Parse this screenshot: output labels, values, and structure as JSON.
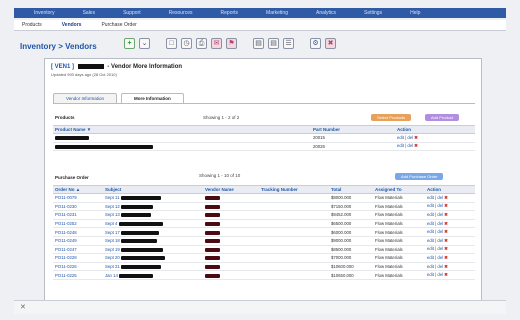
{
  "nav": {
    "top_items": [
      "Inventory",
      "Sales",
      "Support",
      "Resources",
      "Reports",
      "Marketing",
      "Analytics",
      "Settings",
      "Help"
    ],
    "sub_items": [
      {
        "label": "Products",
        "active": false
      },
      {
        "label": "Vendors",
        "active": true
      },
      {
        "label": "Purchase Order",
        "active": false
      }
    ]
  },
  "breadcrumb": "Inventory > Vendors",
  "toolbar_icons": [
    "add-icon",
    "chevron-icon",
    "window-icon",
    "clock-icon",
    "print-icon",
    "email-icon",
    "tag-icon",
    "doc-icon",
    "doc-icon",
    "list-icon",
    "settings-icon",
    "tools-icon"
  ],
  "vendor": {
    "ref": "[ VEN1 ]",
    "title_suffix": "- Vendor More Information",
    "updated": "Updated 993 days ago (28 Oct 2010)"
  },
  "tabs": [
    {
      "label": "Vendor Information",
      "active": false
    },
    {
      "label": "More Information",
      "active": true
    }
  ],
  "products": {
    "label": "Products",
    "showing": "Showing 1 - 2 of 2",
    "select_button": "Select Products",
    "add_button": "Add Product",
    "columns": [
      "Product Name ▼",
      "Part Number",
      "Action"
    ],
    "rows": [
      {
        "part": "20015",
        "action": "edit | del"
      },
      {
        "part": "20026",
        "action": "edit | del"
      }
    ]
  },
  "purchase_orders": {
    "label": "Purchase Order",
    "showing": "Showing 1 - 10 of 10",
    "add_button": "Add Purchase Order",
    "columns": [
      "Order No ▲",
      "Subject",
      "Vendor Name",
      "Tracking Number",
      "Total",
      "Assigned To",
      "Action"
    ],
    "rows": [
      {
        "order": "PO11-0079",
        "subject": "Sept 11",
        "total": "$8000.000",
        "assigned": "Flow Materials",
        "action": "edit | del"
      },
      {
        "order": "PO11-0230",
        "subject": "Sept 12",
        "total": "$7150.000",
        "assigned": "Flow Materials",
        "action": "edit | del"
      },
      {
        "order": "PO11-0231",
        "subject": "Sept 13",
        "total": "$9452.000",
        "assigned": "Flow Materials",
        "action": "edit | del"
      },
      {
        "order": "PO11-0252",
        "subject": "Sept 4",
        "total": "$6500.000",
        "assigned": "Flow Materials",
        "action": "edit | del"
      },
      {
        "order": "PO11-0248",
        "subject": "Sept 17",
        "total": "$6000.000",
        "assigned": "Flow Materials",
        "action": "edit | del"
      },
      {
        "order": "PO11-0249",
        "subject": "Sept 18",
        "total": "$9000.000",
        "assigned": "Flow Materials",
        "action": "edit | del"
      },
      {
        "order": "PO11-0247",
        "subject": "Sept 19",
        "total": "$8500.000",
        "assigned": "Flow Materials",
        "action": "edit | del"
      },
      {
        "order": "PO11-0228",
        "subject": "Sept 20",
        "total": "$7000.000",
        "assigned": "Flow Materials",
        "action": "edit | del"
      },
      {
        "order": "PO11-0226",
        "subject": "Sept 21",
        "total": "$10600.000",
        "assigned": "Flow Materials",
        "action": "edit | del"
      },
      {
        "order": "PO11-0225",
        "subject": "Jan 14",
        "total": "$10650.000",
        "assigned": "Flow Materials",
        "action": "edit | del"
      }
    ]
  },
  "colors": {
    "brand": "#2f5aa6",
    "link": "#1f55a8",
    "delete": "#d0342c"
  }
}
